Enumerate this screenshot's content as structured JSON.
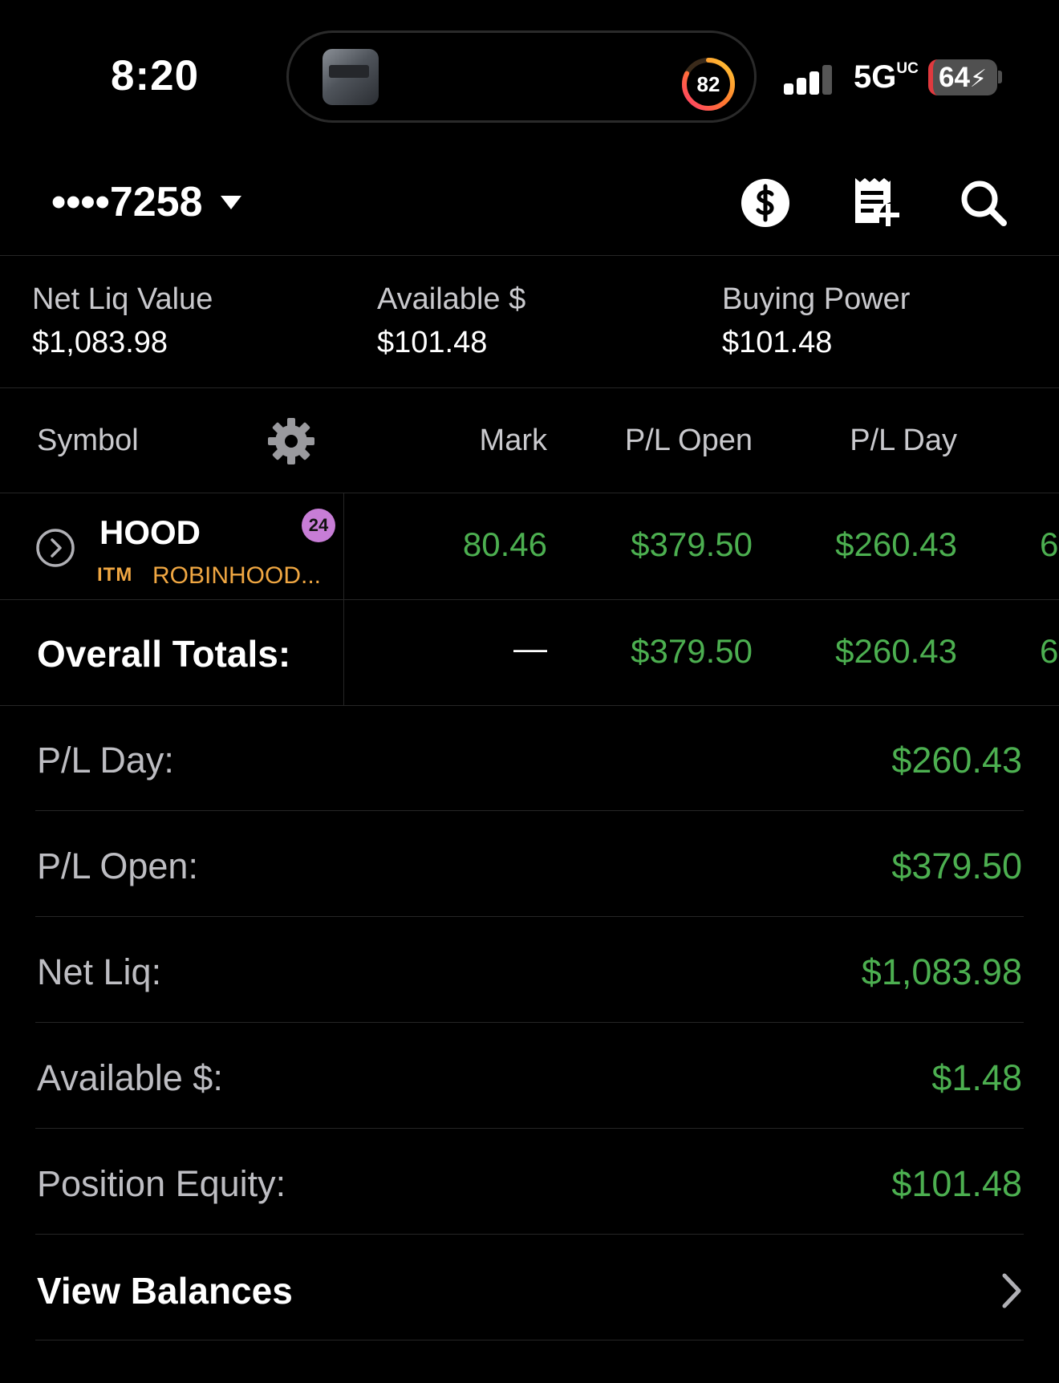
{
  "status_bar": {
    "time": "8:20",
    "activity_ring_value": "82",
    "network": "5G",
    "network_suffix": "UC",
    "battery": "64"
  },
  "header": {
    "account": "••••7258",
    "icons": [
      "dollar-circle-icon",
      "receipt-add-icon",
      "search-icon"
    ]
  },
  "summary": {
    "items": [
      {
        "label": "Net Liq Value",
        "value": "$1,083.98"
      },
      {
        "label": "Available $",
        "value": "$101.48"
      },
      {
        "label": "Buying Power",
        "value": "$101.48"
      }
    ]
  },
  "table": {
    "headers": {
      "symbol": "Symbol",
      "mark": "Mark",
      "pl_open": "P/L Open",
      "pl_day": "P/L Day"
    },
    "rows": [
      {
        "symbol": "HOOD",
        "tag": "ITM",
        "description": "ROBINHOOD...",
        "badge": "24",
        "mark": "80.46",
        "pl_open": "$379.50",
        "pl_day": "$260.43",
        "next": "6"
      }
    ],
    "totals": {
      "label": "Overall Totals:",
      "mark": "—",
      "pl_open": "$379.50",
      "pl_day": "$260.43",
      "next": "6"
    }
  },
  "details": {
    "rows": [
      {
        "label": "P/L Day:",
        "value": "$260.43"
      },
      {
        "label": "P/L Open:",
        "value": "$379.50"
      },
      {
        "label": "Net Liq:",
        "value": "$1,083.98"
      },
      {
        "label": "Available $:",
        "value": "$1.48"
      },
      {
        "label": "Position Equity:",
        "value": "$101.48"
      }
    ],
    "view_balances": "View Balances"
  },
  "colors": {
    "background": "#000000",
    "positive": "#4caf50",
    "itm": "#f0a742",
    "badge": "#c77dd6"
  }
}
